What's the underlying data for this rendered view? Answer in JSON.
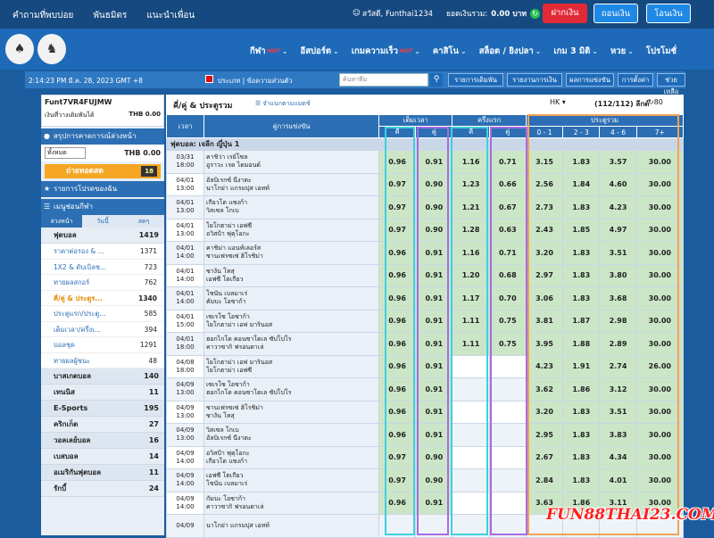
{
  "top": {
    "links": [
      "คำถามที่พบบ่อย",
      "พันธมิตร",
      "แนะนำเพื่อน"
    ],
    "greeting": "สวัสดี, Funthai1234",
    "balance_label": "ยอดเงินรวม:",
    "balance": "0.00 บาท",
    "deposit": "ฝากเงิน",
    "withdraw": "ถอนเงิน",
    "transfer": "โอนเงิน"
  },
  "nav": {
    "items": [
      {
        "label": "กีฬา",
        "hot": "HOT"
      },
      {
        "label": "อีสปอร์ต",
        "hot": ""
      },
      {
        "label": "เกมความเร็ว",
        "hot": "HOT"
      },
      {
        "label": "คาสิโน",
        "hot": ""
      },
      {
        "label": "สล็อต / ยิงปลา",
        "hot": ""
      },
      {
        "label": "เกม 3 มิติ",
        "hot": ""
      },
      {
        "label": "หวย",
        "hot": ""
      },
      {
        "label": "โปรโมชั่",
        "hot": ""
      }
    ]
  },
  "subbar": {
    "clock": "2:14:23 PM มี.ค. 28, 2023 GMT +8",
    "lang": "ประเภท | ข้อความส่วนตัว",
    "search_placeholder": "ค้นหาทีม",
    "buttons": [
      "รายการเดิมพัน",
      "รายงานการเงิน",
      "ผลการแข่งขัน",
      "การตั้งค่า",
      "ช่วยเหลือ"
    ]
  },
  "account": {
    "name": "Funt7VR4FUJMW",
    "credit_label": "เงินที่วางเดิมพันได้",
    "credit": "THB 0.00",
    "panel_title": "สรุปการคาดการณ์ล่วงหน้า",
    "select": "ทั้งหมด",
    "select_val": "THB 0.00",
    "live_label": "ถ่ายทอดสด",
    "live_count": "18",
    "bets_title": "รายการโปรดของฉัน",
    "menu_title": "เมนูช่อนกีฬา",
    "tabs": [
      "ล่วงหน้า",
      "วันนี้",
      "สดๆ"
    ]
  },
  "sports": [
    {
      "name": "ฟุตบอล",
      "count": "1419",
      "subs": [
        {
          "name": "ราคาต่อรอง & ...",
          "count": "1371"
        },
        {
          "name": "1X2 & ดับเบิลช...",
          "count": "723"
        },
        {
          "name": "ทายผลสกอร์",
          "count": "762"
        },
        {
          "name": "คี่/คู่ & ประตูร...",
          "count": "1340",
          "on": true
        },
        {
          "name": "ประตูแรก/ประตู...",
          "count": "585"
        },
        {
          "name": "เต็มเวลา/ครึ่งเ...",
          "count": "394"
        },
        {
          "name": "บอลชุด",
          "count": "1291"
        },
        {
          "name": "ทายผลผู้ชนะ",
          "count": "48"
        }
      ]
    },
    {
      "name": "บาสเกตบอล",
      "count": "140"
    },
    {
      "name": "เทนนิส",
      "count": "11"
    },
    {
      "name": "E-Sports",
      "count": "195"
    },
    {
      "name": "คริกเก็ต",
      "count": "27"
    },
    {
      "name": "วอลเลย์บอล",
      "count": "16"
    },
    {
      "name": "เบสบอล",
      "count": "14"
    },
    {
      "name": "อเมริกันฟุตบอล",
      "count": "11"
    },
    {
      "name": "รักบี้",
      "count": "24"
    }
  ],
  "main": {
    "title": "คี่/คู่ & ประตูรวม",
    "list_label": "จำแนกตามแมตช์",
    "odds_type": "HK",
    "count": "(112/112) ลีกต์",
    "refresh_val": "80",
    "headers": {
      "time": "เวลา",
      "match": "คู่การแข่งขัน",
      "ft": "เต็มเวลา",
      "ht": "ครึ่งแรก",
      "tg": "ประตูรวม",
      "odd": "คี่",
      "even": "คู่",
      "r1": "0 - 1",
      "r2": "2 - 3",
      "r3": "4 - 6",
      "r4": "7+"
    },
    "league": "ฟุตบอล: เจลีก ญี่ปุ่น 1",
    "rows": [
      {
        "d": "03/31",
        "t": "18:00",
        "h": "คาชิว่า เรย์โซล",
        "a": "อูราวะ เรด ไดมอนด์",
        "fo": "0.96",
        "fe": "0.91",
        "ho": "1.16",
        "he": "0.71",
        "g1": "3.15",
        "g2": "1.83",
        "g3": "3.57",
        "g4": "30.00"
      },
      {
        "d": "04/01",
        "t": "13:00",
        "h": "อัลบิเรกซ์ นีงาตะ",
        "a": "นาโกย่า แกรมปุส เอทท์",
        "fo": "0.97",
        "fe": "0.90",
        "ho": "1.23",
        "he": "0.66",
        "g1": "2.56",
        "g2": "1.84",
        "g3": "4.60",
        "g4": "30.00"
      },
      {
        "d": "04/01",
        "t": "13:00",
        "h": "เกียวโต แซงก้า",
        "a": "วิสเซล โกเบ",
        "fo": "0.97",
        "fe": "0.90",
        "ho": "1.21",
        "he": "0.67",
        "g1": "2.73",
        "g2": "1.83",
        "g3": "4.23",
        "g4": "30.00"
      },
      {
        "d": "04/01",
        "t": "13:00",
        "h": "โยโกฮาม่า เอฟซี",
        "a": "อวิสป้า ฟุคุโอกะ",
        "fo": "0.97",
        "fe": "0.90",
        "ho": "1.28",
        "he": "0.63",
        "g1": "2.43",
        "g2": "1.85",
        "g3": "4.97",
        "g4": "30.00"
      },
      {
        "d": "04/01",
        "t": "14:00",
        "h": "คาชิม่า แอนท์เลอร์ส",
        "a": "ซานเฟรซเซ่ ฮิโรชิม่า",
        "fo": "0.96",
        "fe": "0.91",
        "ho": "1.16",
        "he": "0.71",
        "g1": "3.20",
        "g2": "1.83",
        "g3": "3.51",
        "g4": "30.00"
      },
      {
        "d": "04/01",
        "t": "14:00",
        "h": "ซางัน โทสุ",
        "a": "เอฟซี โตเกียว",
        "fo": "0.96",
        "fe": "0.91",
        "ho": "1.20",
        "he": "0.68",
        "g1": "2.97",
        "g2": "1.83",
        "g3": "3.80",
        "g4": "30.00"
      },
      {
        "d": "04/01",
        "t": "14:00",
        "h": "โชนัน เบลมาเร่",
        "a": "คัมบะ โอซาก้า",
        "fo": "0.96",
        "fe": "0.91",
        "ho": "1.17",
        "he": "0.70",
        "g1": "3.06",
        "g2": "1.83",
        "g3": "3.68",
        "g4": "30.00"
      },
      {
        "d": "04/01",
        "t": "15:00",
        "h": "เซเรโซ โอซาก้า",
        "a": "โยโกฮาม่า เอฟ มารินอส",
        "fo": "0.96",
        "fe": "0.91",
        "ho": "1.11",
        "he": "0.75",
        "g1": "3.81",
        "g2": "1.87",
        "g3": "2.98",
        "g4": "30.00"
      },
      {
        "d": "04/01",
        "t": "18:00",
        "h": "ฮอกไกโด คอนซาโดเล ซัปโปโร",
        "a": "คาวาซากิ ฟรอนตาเล่",
        "fo": "0.96",
        "fe": "0.91",
        "ho": "1.11",
        "he": "0.75",
        "g1": "3.95",
        "g2": "1.88",
        "g3": "2.89",
        "g4": "30.00"
      },
      {
        "d": "04/08",
        "t": "18:00",
        "h": "โยโกฮาม่า เอฟ มารินอส",
        "a": "โยโกฮาม่า เอฟซี",
        "fo": "0.96",
        "fe": "0.91",
        "ho": "",
        "he": "",
        "g1": "4.23",
        "g2": "1.91",
        "g3": "2.74",
        "g4": "26.00"
      },
      {
        "d": "04/09",
        "t": "13:00",
        "h": "เซเรโซ โอซาก้า",
        "a": "ฮอกไกโด คอนซาโดเล ซัปโปโร",
        "fo": "0.96",
        "fe": "0.91",
        "ho": "",
        "he": "",
        "g1": "3.62",
        "g2": "1.86",
        "g3": "3.12",
        "g4": "30.00"
      },
      {
        "d": "04/09",
        "t": "13:00",
        "h": "ซานเฟรซเซ่ ฮิโรชิม่า",
        "a": "ซางัน โทสุ",
        "fo": "0.96",
        "fe": "0.91",
        "ho": "",
        "he": "",
        "g1": "3.20",
        "g2": "1.83",
        "g3": "3.51",
        "g4": "30.00"
      },
      {
        "d": "04/09",
        "t": "13:00",
        "h": "วิสเซล โกเบ",
        "a": "อัลบิเรกซ์ นีงาตะ",
        "fo": "0.96",
        "fe": "0.91",
        "ho": "",
        "he": "",
        "g1": "2.95",
        "g2": "1.83",
        "g3": "3.83",
        "g4": "30.00"
      },
      {
        "d": "04/09",
        "t": "14:00",
        "h": "อวิสป้า ฟุคุโอกะ",
        "a": "เกียวโต แซงก้า",
        "fo": "0.97",
        "fe": "0.90",
        "ho": "",
        "he": "",
        "g1": "2.67",
        "g2": "1.83",
        "g3": "4.34",
        "g4": "30.00"
      },
      {
        "d": "04/09",
        "t": "14:00",
        "h": "เอฟซี โตเกียว",
        "a": "โชนัน เบลมาเร่",
        "fo": "0.97",
        "fe": "0.90",
        "ho": "",
        "he": "",
        "g1": "2.84",
        "g2": "1.83",
        "g3": "4.01",
        "g4": "30.00"
      },
      {
        "d": "04/09",
        "t": "14:00",
        "h": "กัมบะ โอซาก้า",
        "a": "คาวาซากิ ฟรอนตาเล่",
        "fo": "0.96",
        "fe": "0.91",
        "ho": "",
        "he": "",
        "g1": "3.63",
        "g2": "1.86",
        "g3": "3.11",
        "g4": "30.00"
      },
      {
        "d": "04/09",
        "t": "",
        "h": "นาโกย่า แกรมปุส เอทท์",
        "a": "",
        "fo": "",
        "fe": "",
        "ho": "",
        "he": "",
        "g1": "",
        "g2": "",
        "g3": "",
        "g4": ""
      }
    ]
  },
  "brand": "FUN88THAI23.COM"
}
